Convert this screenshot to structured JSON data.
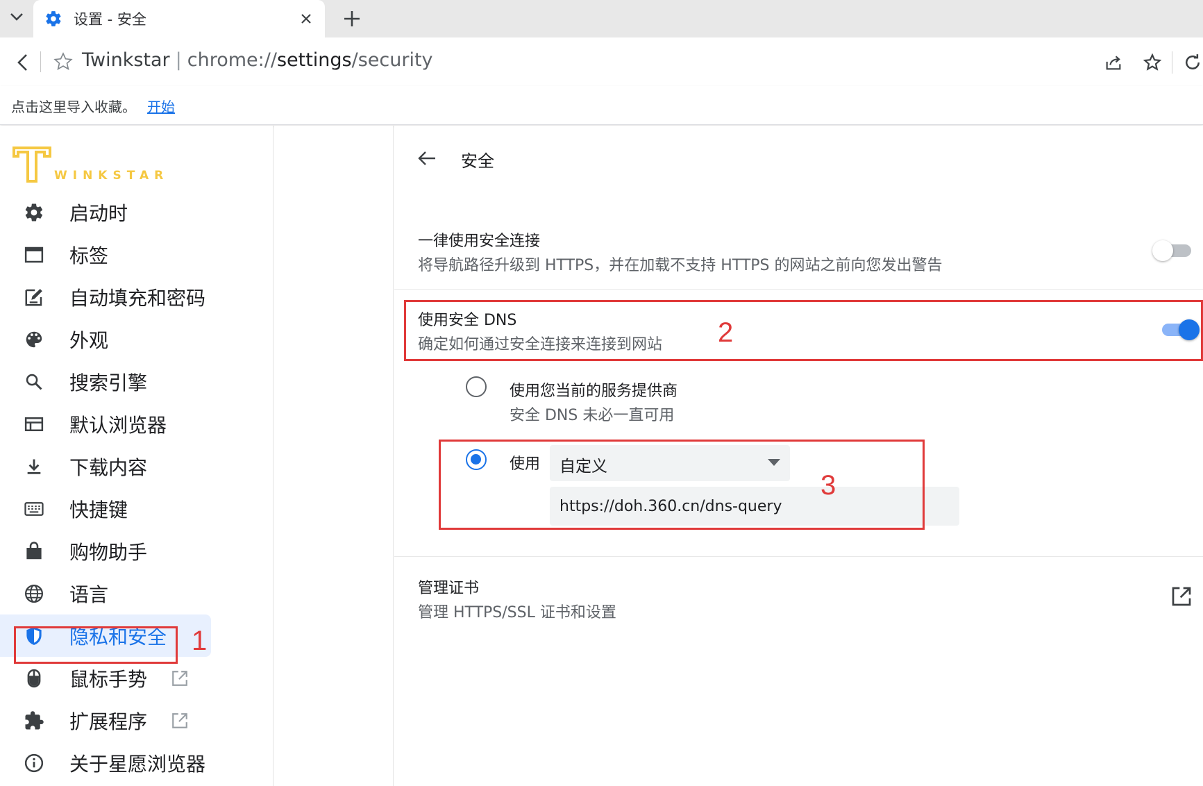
{
  "tab": {
    "title": "设置 - 安全",
    "icon": "gear-icon",
    "close_glyph": "✕",
    "new_tab_glyph": "+"
  },
  "address_bar": {
    "site_name": "Twinkstar",
    "separator": "|",
    "url_scheme": "chrome://",
    "url_host": "settings",
    "url_path": "/security"
  },
  "bookmark_bar": {
    "prompt": "点击这里导入收藏。",
    "link": "开始"
  },
  "sidebar": {
    "logo_text": "WINKSTAR",
    "items": [
      {
        "label": "启动时",
        "icon": "gear-icon"
      },
      {
        "label": "标签",
        "icon": "tab-window-icon"
      },
      {
        "label": "自动填充和密码",
        "icon": "edit-form-icon"
      },
      {
        "label": "外观",
        "icon": "palette-icon"
      },
      {
        "label": "搜索引擎",
        "icon": "search-icon"
      },
      {
        "label": "默认浏览器",
        "icon": "browser-icon"
      },
      {
        "label": "下载内容",
        "icon": "download-icon"
      },
      {
        "label": "快捷键",
        "icon": "keyboard-icon"
      },
      {
        "label": "购物助手",
        "icon": "shopping-bag-icon"
      },
      {
        "label": "语言",
        "icon": "globe-icon"
      },
      {
        "label": "隐私和安全",
        "icon": "shield-icon"
      },
      {
        "label": "鼠标手势",
        "icon": "mouse-icon"
      },
      {
        "label": "扩展程序",
        "icon": "puzzle-icon"
      },
      {
        "label": "关于星愿浏览器",
        "icon": "info-icon"
      }
    ],
    "active_index": 10
  },
  "main": {
    "page_title": "安全",
    "https_row": {
      "title": "一律使用安全连接",
      "subtitle": "将导航路径升级到 HTTPS，并在加载不支持 HTTPS 的网站之前向您发出警告",
      "enabled": false
    },
    "dns_row": {
      "title": "使用安全 DNS",
      "subtitle": "确定如何通过安全连接来连接到网站",
      "enabled": true
    },
    "dns_option_current": {
      "title": "使用您当前的服务提供商",
      "subtitle": "安全 DNS 未必一直可用",
      "selected": false
    },
    "dns_option_custom": {
      "label": "使用",
      "provider": "自定义",
      "url": "https://doh.360.cn/dns-query",
      "selected": true
    },
    "cert_row": {
      "title": "管理证书",
      "subtitle": "管理 HTTPS/SSL 证书和设置"
    }
  },
  "annotations": {
    "marker_1": "1",
    "marker_2": "2",
    "marker_3": "3",
    "color": "#e03a3a"
  },
  "colors": {
    "accent": "#1a73e8",
    "logo": "#f5c842"
  }
}
